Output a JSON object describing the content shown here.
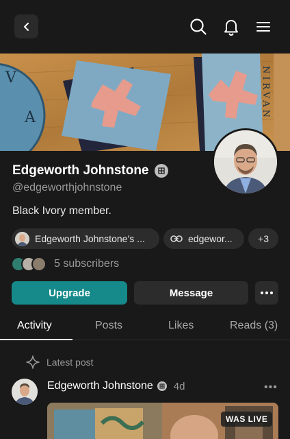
{
  "topbar": {
    "back_icon": "chevron-left-icon",
    "search_icon": "search-icon",
    "bell_icon": "bell-icon",
    "menu_icon": "menu-icon"
  },
  "banner": {
    "vertical_text": "NIRVAN",
    "clock_letters": [
      "A",
      "V"
    ]
  },
  "profile": {
    "name": "Edgeworth Johnstone",
    "handle": "@edgeworthjohnstone",
    "bio": "Black Ivory member.",
    "chips": [
      {
        "label": "Edgeworth Johnstone’s ..."
      },
      {
        "label": "edgewor..."
      },
      {
        "label": "+3"
      }
    ],
    "subscribers": "5 subscribers"
  },
  "actions": {
    "upgrade": "Upgrade",
    "message": "Message",
    "more": "•••"
  },
  "tabs": [
    {
      "label": "Activity"
    },
    {
      "label": "Posts"
    },
    {
      "label": "Likes"
    },
    {
      "label": "Reads (3)"
    }
  ],
  "feed": {
    "section_label": "Latest post",
    "post": {
      "author": "Edgeworth Johnstone",
      "time": "4d",
      "more": "•••",
      "live_badge": "WAS LIVE"
    }
  },
  "colors": {
    "background": "#191919",
    "accent": "#168a8a",
    "surface": "#2c2c2c",
    "muted_text": "#9a9a9a"
  }
}
